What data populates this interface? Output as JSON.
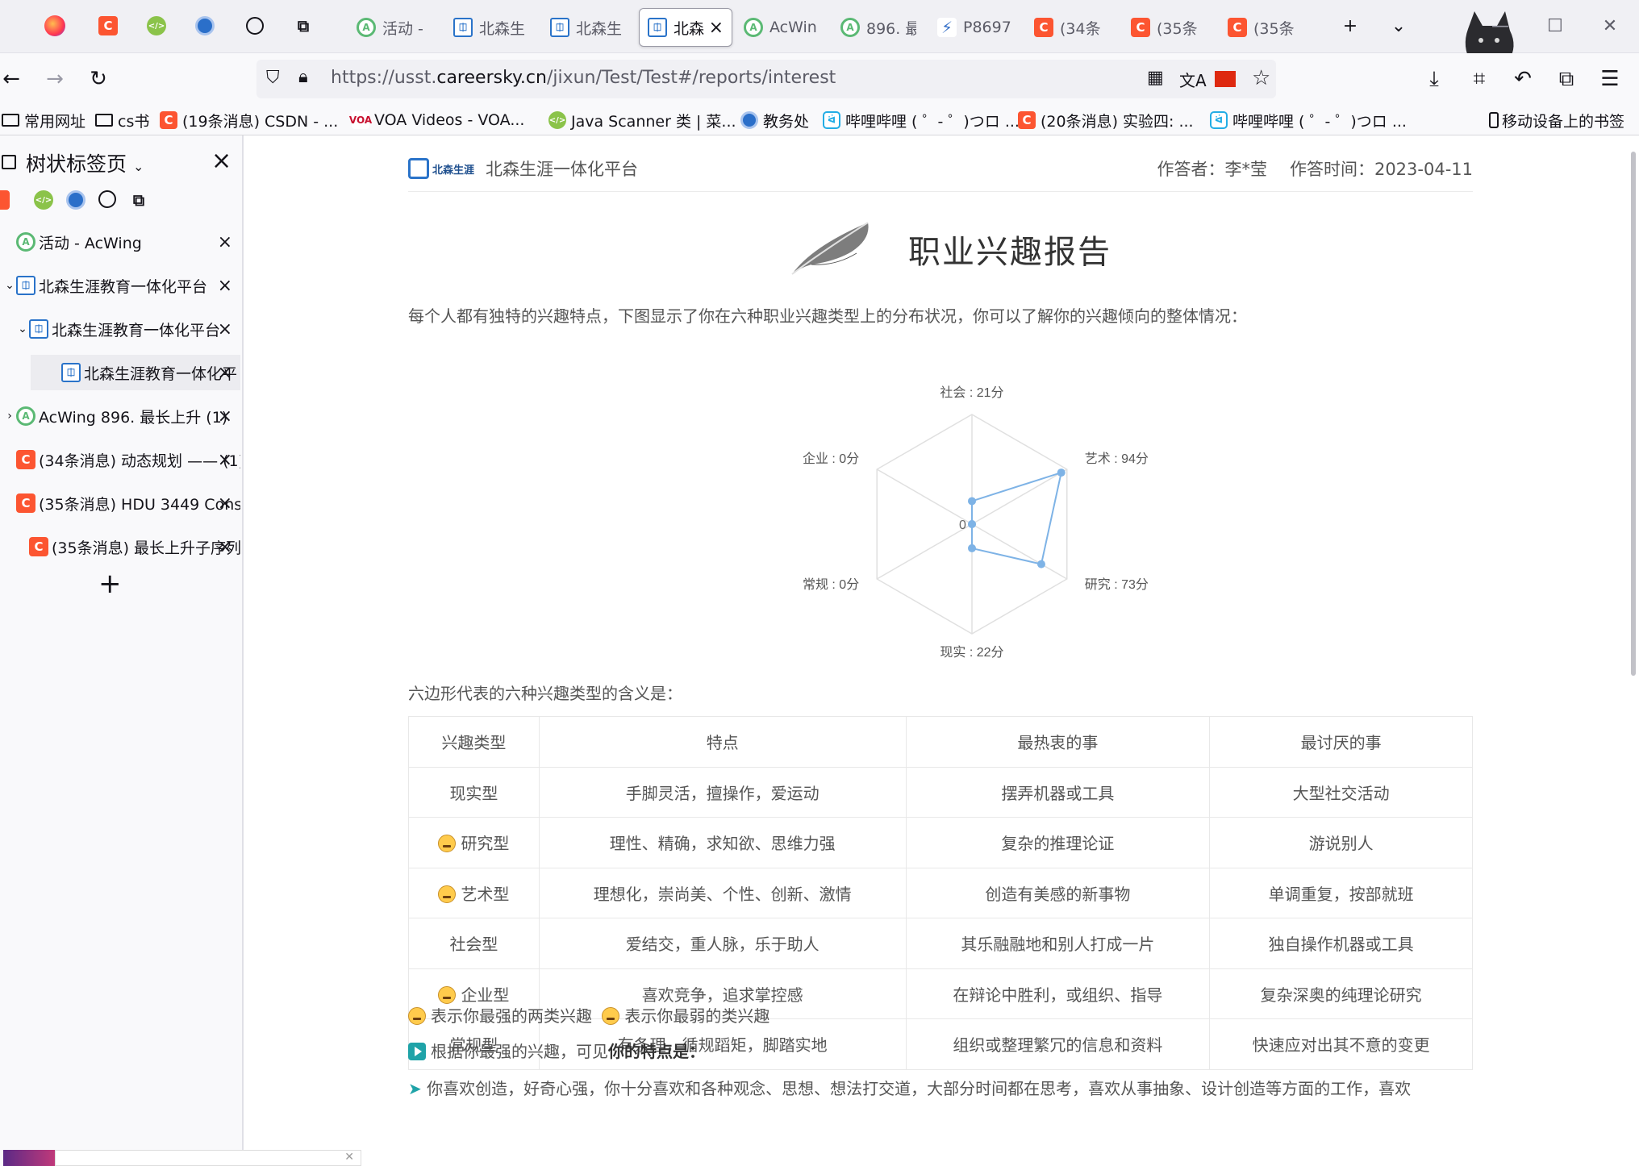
{
  "tabs": {
    "pinned": [
      {
        "name": "firefox-view",
        "icon": "firefox-icon"
      },
      {
        "name": "csdn",
        "icon": "csdn-icon"
      },
      {
        "name": "js-ext",
        "icon": "code-icon"
      },
      {
        "name": "jw",
        "icon": "jw-icon"
      },
      {
        "name": "web",
        "icon": "globe-icon"
      },
      {
        "name": "extension",
        "icon": "puzzle-icon"
      }
    ],
    "items": [
      {
        "label": "活动 - ",
        "icon": "acwing"
      },
      {
        "label": "北森生",
        "icon": "bs"
      },
      {
        "label": "北森生",
        "icon": "bs"
      },
      {
        "label": "北森",
        "icon": "bs",
        "active": true,
        "close": "×"
      },
      {
        "label": "AcWin",
        "icon": "acwing"
      },
      {
        "label": "896. 最",
        "icon": "acwing"
      },
      {
        "label": "P8697",
        "icon": "luogu"
      },
      {
        "label": "(34条",
        "icon": "csdn"
      },
      {
        "label": "(35条",
        "icon": "csdn"
      },
      {
        "label": "(35条",
        "icon": "csdn"
      }
    ],
    "new_tab": "+",
    "list_all": "⌄"
  },
  "nav": {
    "url_prefix": "https://usst.",
    "url_host": "careersky.cn",
    "url_path": "/jixun/Test/Test#/reports/interest"
  },
  "bookmarks": [
    {
      "label": "常用网址",
      "icon": "folder"
    },
    {
      "label": "cs书",
      "icon": "folder"
    },
    {
      "label": "(19条消息) CSDN - ...",
      "icon": "csdn"
    },
    {
      "label": "VOA Videos - VOA...",
      "icon": "voa"
    },
    {
      "label": "Java Scanner 类 | 菜...",
      "icon": "js"
    },
    {
      "label": "教务处",
      "icon": "jw"
    },
    {
      "label": "哔哩哔哩 ( ゜- ゜)つロ ...",
      "icon": "bili"
    },
    {
      "label": "(20条消息) 实验四: ...",
      "icon": "csdn"
    },
    {
      "label": "哔哩哔哩 ( ゜- ゜)つロ ...",
      "icon": "bili"
    },
    {
      "label": "移动设备上的书签",
      "icon": "mobile"
    }
  ],
  "sidebar": {
    "title": "树状标签页",
    "close": "×",
    "add": "+",
    "items": [
      {
        "label": "活动 - AcWing",
        "icon": "acwing",
        "indent": 0,
        "twisty": ""
      },
      {
        "label": "北森生涯教育一体化平台",
        "icon": "bs",
        "indent": 0,
        "twisty": "⌄"
      },
      {
        "label": "北森生涯教育一体化平台",
        "icon": "bs",
        "indent": 1,
        "twisty": "⌄"
      },
      {
        "label": "北森生涯教育一体化平",
        "icon": "bs",
        "indent": 2,
        "twisty": "",
        "active": true
      },
      {
        "label": "AcWing 896. 最长上升 (1)",
        "icon": "acwing",
        "indent": 0,
        "twisty": "›"
      },
      {
        "label": "(34条消息) 动态规划 —— (1)",
        "icon": "csdn",
        "indent": 0,
        "twisty": ""
      },
      {
        "label": "(35条消息) HDU 3449 Cons",
        "icon": "csdn",
        "indent": 0,
        "twisty": ""
      },
      {
        "label": "(35条消息) 最长上升子序列",
        "icon": "csdn",
        "indent": 1,
        "twisty": ""
      }
    ]
  },
  "report": {
    "brand": "北森生涯",
    "platform": "北森生涯一体化平台",
    "respondent": "作答者：李*莹",
    "answer_time": "作答时间：2023-04-11",
    "title": "职业兴趣报告",
    "intro": "每个人都有独特的兴趣特点，下图显示了你在六种职业兴趣类型上的分布状况，你可以了解你的兴趣倾向的整体情况：",
    "table_intro": "六边形代表的六种兴趣类型的含义是：",
    "legend_strong": "表示你最强的两类兴趣",
    "legend_weak": "表示你最弱的类兴趣",
    "trait_prefix": "根据你最强的兴趣，可见",
    "trait_bold": "你的特点是：",
    "cut_line": "你喜欢创造，好奇心强，你十分喜欢和各种观念、思想、想法打交道，大部分时间都在思考，喜欢从事抽象、设计创造等方面的工作，喜欢"
  },
  "chart_data": {
    "type": "radar",
    "categories": [
      "社会",
      "艺术",
      "研究",
      "现实",
      "常规",
      "企业"
    ],
    "values": [
      21,
      94,
      73,
      22,
      0,
      0
    ],
    "value_labels": [
      "社会 : 21分",
      "艺术 : 94分",
      "研究 : 73分",
      "现实 : 22分",
      "常规 : 0分",
      "企业 : 0分"
    ],
    "center_label": "0",
    "max": 100,
    "color": "#7eb3e6"
  },
  "table": {
    "headers": [
      "兴趣类型",
      "特点",
      "最热衷的事",
      "最讨厌的事"
    ],
    "rows": [
      {
        "type": "现实型",
        "mark": "",
        "traits": "手脚灵活，擅操作，爱运动",
        "likes": "摆弄机器或工具",
        "dislikes": "大型社交活动"
      },
      {
        "type": "研究型",
        "mark": "strong",
        "traits": "理性、精确，求知欲、思维力强",
        "likes": "复杂的推理论证",
        "dislikes": "游说别人"
      },
      {
        "type": "艺术型",
        "mark": "strong",
        "traits": "理想化，崇尚美、个性、创新、激情",
        "likes": "创造有美感的新事物",
        "dislikes": "单调重复，按部就班"
      },
      {
        "type": "社会型",
        "mark": "",
        "traits": "爱结交，重人脉，乐于助人",
        "likes": "其乐融融地和别人打成一片",
        "dislikes": "独自操作机器或工具"
      },
      {
        "type": "企业型",
        "mark": "weak",
        "traits": "喜欢竞争，追求掌控感",
        "likes": "在辩论中胜利，或组织、指导",
        "dislikes": "复杂深奥的纯理论研究"
      },
      {
        "type": "常规型",
        "mark": "",
        "traits": "有条理，循规蹈矩，脚踏实地",
        "likes": "组织或整理繁冗的信息和资料",
        "dislikes": "快速应对出其不意的变更"
      }
    ]
  }
}
